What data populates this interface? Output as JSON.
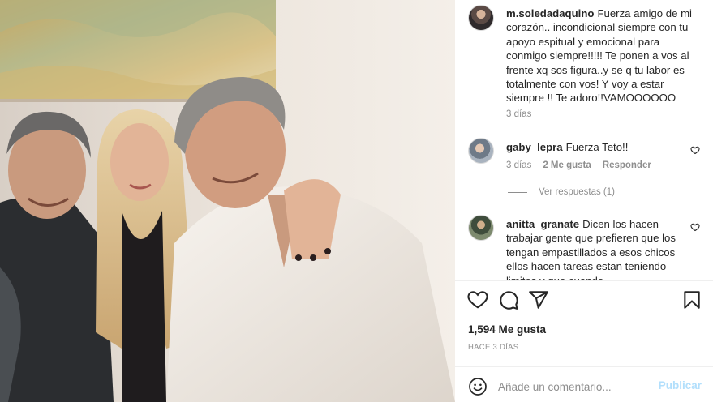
{
  "post": {
    "caption_comment": {
      "username": "m.soledadaquino",
      "text": "Fuerza amigo de mi corazón.. incondicional siempre con tu apoyo espitual y emocional para conmigo siempre!!!!! Te ponen a vos al frente xq sos figura..y se q tu labor es totalmente con vos! Y voy a estar siempre !! Te adoro!!VAMOOOOOO",
      "time": "3 días"
    },
    "comments": [
      {
        "username": "gaby_lepra",
        "text": "Fuerza Teto!!",
        "time": "3 días",
        "likes": "2 Me gusta",
        "reply": "Responder",
        "view_replies": "Ver respuestas (1)"
      },
      {
        "username": "anitta_granate",
        "text": "Dicen los hacen trabajar gente que prefieren que los tengan empastillados a esos chicos ellos hacen tareas estan teniendo limites y que cuando"
      }
    ],
    "likes_count": "1,594 Me gusta",
    "posted_ago": "HACE 3 DÍAS",
    "composer": {
      "placeholder": "Añade un comentario...",
      "submit_label": "Publicar"
    }
  },
  "icons": {
    "like": "heart-icon",
    "comment": "comment-icon",
    "share": "share-icon",
    "save": "bookmark-icon",
    "comment_like": "heart-icon",
    "emoji": "emoji-icon"
  },
  "colors": {
    "text": "#262626",
    "muted": "#8e8e8e",
    "publish_disabled": "#b2dffc"
  }
}
